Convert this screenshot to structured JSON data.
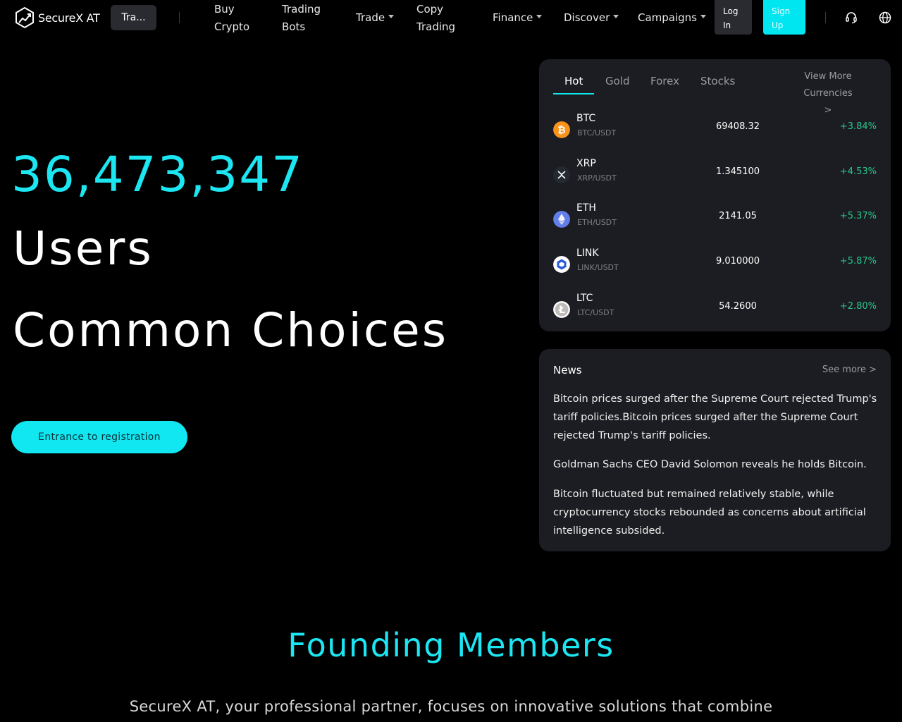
{
  "brand": {
    "name": "SecureX AT"
  },
  "header": {
    "pill_tab": "Tra...",
    "nav": [
      {
        "label_line1": "Buy",
        "label_line2": "Crypto"
      },
      {
        "label_line1": "Trading",
        "label_line2": "Bots"
      },
      {
        "label": "Trade"
      },
      {
        "label_line1": "Copy",
        "label_line2": "Trading"
      },
      {
        "label": "Finance"
      },
      {
        "label": "Discover"
      },
      {
        "label": "Campaigns"
      }
    ],
    "login": {
      "line1": "Log",
      "line2": "In"
    },
    "signup": {
      "line1": "Sign",
      "line2": "Up"
    },
    "icons": [
      "headset-icon",
      "globe-icon"
    ]
  },
  "hero": {
    "count": "36,473,347",
    "line1": "Users",
    "line2": "Common Choices",
    "cta": "Entrance to registration"
  },
  "market": {
    "tabs": [
      "Hot",
      "Gold",
      "Forex",
      "Stocks"
    ],
    "active_tab": "Hot",
    "view_more": "View More Currencies",
    "view_more_arrow": ">",
    "rows": [
      {
        "name": "BTC",
        "pair": "BTC/USDT",
        "price": "69408.32",
        "change": "+3.84%",
        "icon": "bitcoin-icon",
        "color": "#f7931a"
      },
      {
        "name": "XRP",
        "pair": "XRP/USDT",
        "price": "1.345100",
        "change": "+4.53%",
        "icon": "xrp-icon",
        "color": "#23292f"
      },
      {
        "name": "ETH",
        "pair": "ETH/USDT",
        "price": "2141.05",
        "change": "+5.37%",
        "icon": "ethereum-icon",
        "color": "#627eea"
      },
      {
        "name": "LINK",
        "pair": "LINK/USDT",
        "price": "9.010000",
        "change": "+5.87%",
        "icon": "chainlink-icon",
        "color": "#2a5ada"
      },
      {
        "name": "LTC",
        "pair": "LTC/USDT",
        "price": "54.2600",
        "change": "+2.80%",
        "icon": "litecoin-icon",
        "color": "#ffffff"
      }
    ]
  },
  "news": {
    "title": "News",
    "see_more": "See more >",
    "items": [
      "Bitcoin prices surged after the Supreme Court rejected Trump's tariff policies.Bitcoin prices surged after the Supreme Court rejected Trump's tariff policies.",
      "Goldman Sachs CEO David Solomon reveals he holds Bitcoin.",
      "Bitcoin fluctuated but remained relatively stable, while cryptocurrency stocks rebounded as concerns about artificial intelligence subsided."
    ]
  },
  "founding": {
    "title": "Founding Members",
    "subtitle": "SecureX AT, your professional partner, focuses on innovative solutions that combine"
  },
  "colors": {
    "accent": "#11e7f1",
    "panel": "#1c1d22",
    "positive": "#27c68a"
  }
}
